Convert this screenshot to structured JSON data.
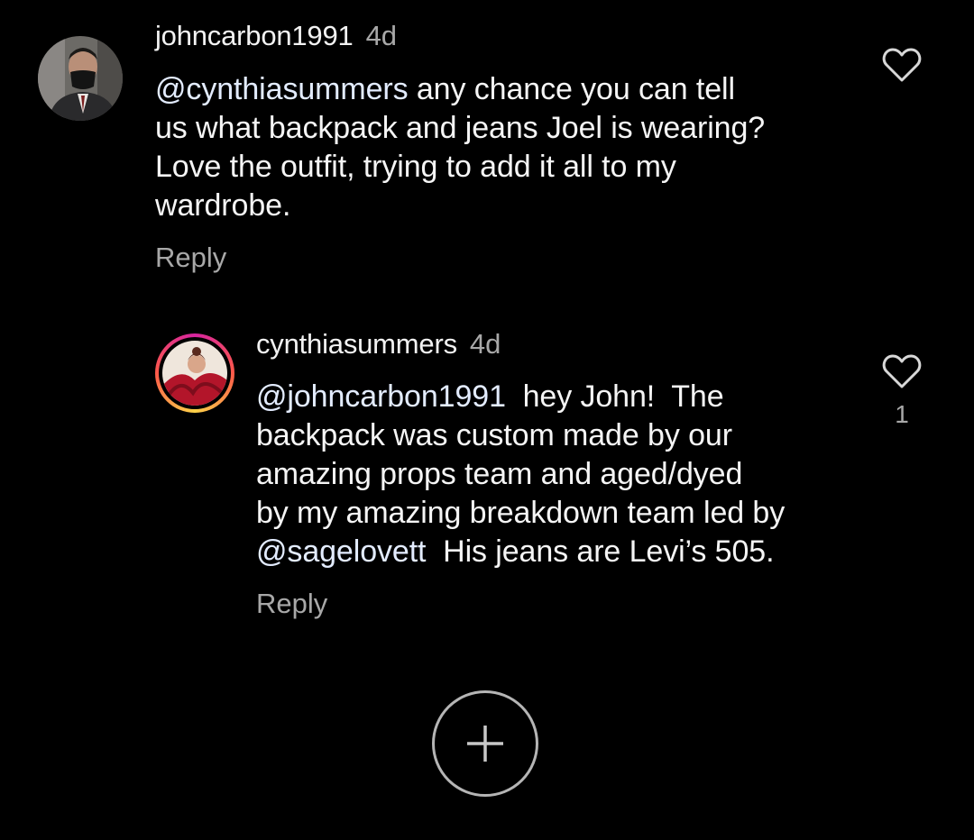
{
  "comments": [
    {
      "username": "johncarbon1991",
      "time": "4d",
      "mention": "@cynthiasummers",
      "lines": [
        " any chance you can tell",
        "us what backpack and jeans Joel is wearing?",
        "Love the outfit, trying to add it all to my",
        "wardrobe."
      ],
      "reply_label": "Reply"
    },
    {
      "username": "cynthiasummers",
      "time": "4d",
      "mention_start": "@johncarbon1991",
      "line1_rest": "  hey John!  The",
      "line2": "backpack was custom made by our",
      "line3": "amazing props team and aged/dyed",
      "line4": "by my amazing breakdown team led by",
      "mention_mid": "@sagelovett",
      "line5_rest": "  His jeans are Levi’s 505.",
      "reply_label": "Reply",
      "like_count": "1"
    }
  ],
  "icons": {
    "like": "heart-outline-icon",
    "add": "plus-circle-icon"
  },
  "colors": {
    "background": "#000000",
    "text": "#f5f5f5",
    "secondary": "#a8a8a8"
  }
}
